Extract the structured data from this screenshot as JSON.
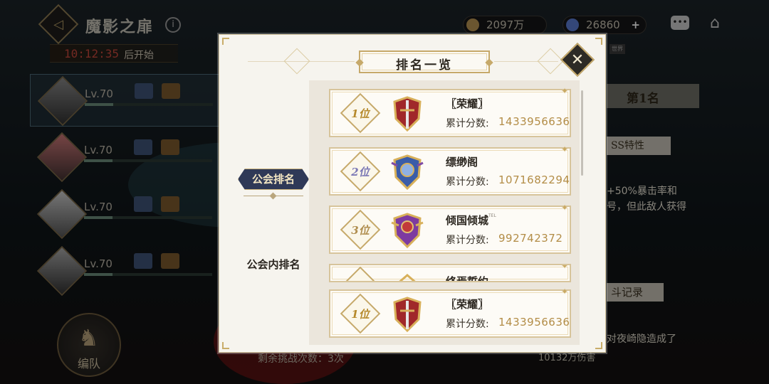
{
  "background": {
    "title": "魔影之扉",
    "info_icon": "i",
    "timer": "10:12:35",
    "timer_suffix": "后开始",
    "currency": [
      {
        "value": "2097万",
        "icon": "gold-coin-icon"
      },
      {
        "value": "26860",
        "icon": "gem-icon",
        "plus": "+"
      }
    ],
    "chat_icon": "•••",
    "home_icon": "⌂",
    "members": [
      {
        "level": "Lv.70"
      },
      {
        "level": "Lv.70"
      },
      {
        "level": "Lv.70"
      },
      {
        "level": "Lv.70"
      }
    ],
    "team_button": "编队",
    "team_icon": "♞",
    "rank_right": "第1名",
    "boss_trait": "SS特性",
    "trait_text_1": "+50%暴击率和",
    "trait_text_2": "号，但此敌人获得",
    "record_title": "斗记录",
    "record_text": "对夜崎隐造成了",
    "record_sub": "10132万伤害",
    "remaining": "剩余挑战次数：3次",
    "small_badge": "世界"
  },
  "modal": {
    "title": "排名一览",
    "close_icon": "✕",
    "tabs": {
      "guild_rank": "公会排名",
      "inner_rank": "公会内排名"
    },
    "score_label": "累计分数:",
    "rows": [
      {
        "rank": "1位",
        "name": "〖荣耀〗",
        "score": "1433956636",
        "emblem": "red-shield-emblem-icon"
      },
      {
        "rank": "2位",
        "name": "缥缈阁",
        "score": "1071682294",
        "emblem": "blue-shield-emblem-icon"
      },
      {
        "rank": "3位",
        "name": "倾国倾城",
        "tag": "TEL",
        "score": "992742372",
        "emblem": "purple-shield-emblem-icon"
      },
      {
        "rank": "",
        "name": "终焉誓约",
        "score": "",
        "emblem": "partial-emblem-icon"
      },
      {
        "rank": "1位",
        "name": "〖荣耀〗",
        "score": "1433956636",
        "emblem": "red-shield-emblem-icon"
      }
    ]
  },
  "colors": {
    "accent_gold": "#c6a96a",
    "score_gold": "#b38d47",
    "tab_navy": "#2f3957",
    "timer_red": "#c5483c"
  }
}
